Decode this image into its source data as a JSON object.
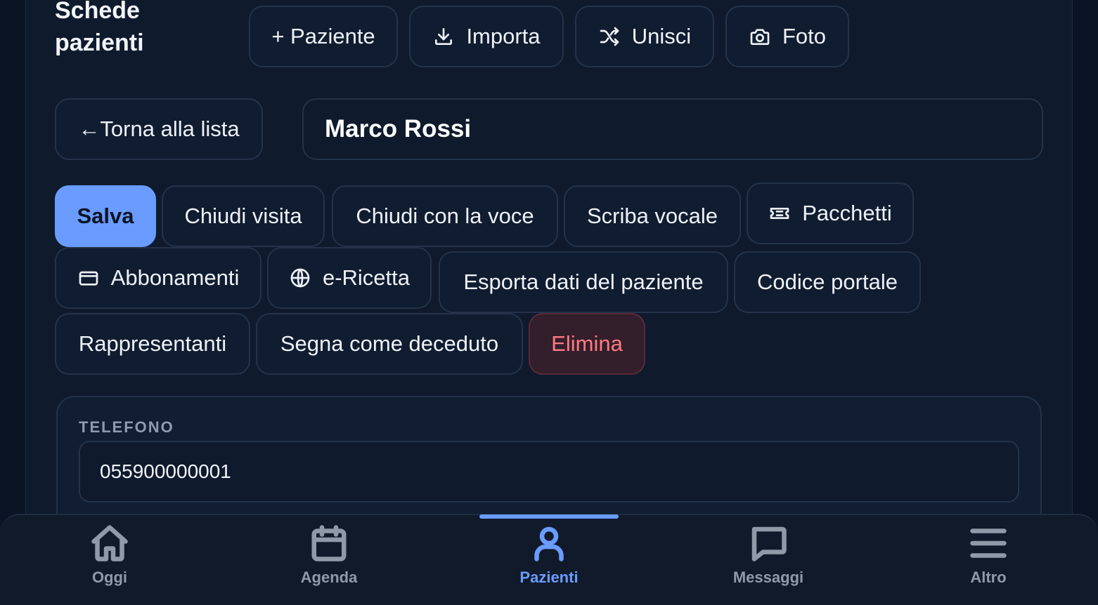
{
  "header": {
    "title": "Schede pazienti",
    "toolbar": {
      "add_patient": "+ Paziente",
      "import": "Importa",
      "merge": "Unisci",
      "photo": "Foto"
    }
  },
  "patient": {
    "back_label": "←Torna alla lista",
    "name": "Marco Rossi"
  },
  "actions": {
    "save": "Salva",
    "close_visit": "Chiudi visita",
    "close_voice": "Chiudi con la voce",
    "voice_scribe": "Scriba vocale",
    "packages": "Pacchetti",
    "subscriptions": "Abbonamenti",
    "e_prescription": "e-Ricetta",
    "export_data": "Esporta dati del paziente",
    "portal_code": "Codice portale",
    "representatives": "Rappresentanti",
    "mark_deceased": "Segna come deceduto",
    "delete": "Elimina"
  },
  "form": {
    "phone_label": "TELEFONO",
    "phone_value": "055900000001"
  },
  "bottom_nav": {
    "items": [
      {
        "label": "Oggi",
        "icon": "home-icon"
      },
      {
        "label": "Agenda",
        "icon": "calendar-icon"
      },
      {
        "label": "Pazienti",
        "icon": "user-icon",
        "active": true
      },
      {
        "label": "Messaggi",
        "icon": "message-icon"
      },
      {
        "label": "Altro",
        "icon": "menu-icon"
      }
    ]
  },
  "colors": {
    "accent": "#6a9cff",
    "danger_text": "#ff7a80",
    "background": "#0f1a2d"
  }
}
